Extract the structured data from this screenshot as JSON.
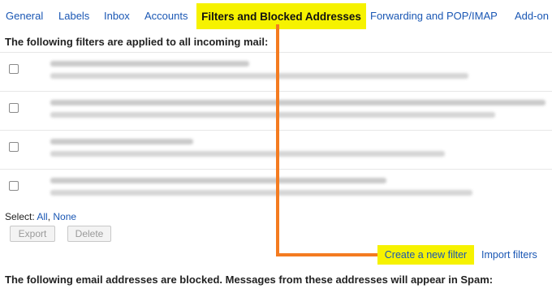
{
  "tabs": {
    "general": "General",
    "labels": "Labels",
    "inbox": "Inbox",
    "accounts": "Accounts",
    "filters": "Filters and Blocked Addresses",
    "forwarding": "Forwarding and POP/IMAP",
    "addons": "Add-on"
  },
  "filters_section": {
    "heading": "The following filters are applied to all incoming mail:"
  },
  "select": {
    "label": "Select:",
    "all": "All",
    "separator": ", ",
    "none": "None"
  },
  "buttons": {
    "export": "Export",
    "delete": "Delete"
  },
  "links": {
    "create_filter": "Create a new filter",
    "import_filters": "Import filters"
  },
  "blocked_section": {
    "heading": "The following email addresses are blocked. Messages from these addresses will appear in Spam:"
  },
  "colors": {
    "link": "#1a57b4",
    "highlight": "#f6f200",
    "annotation": "#f47b20"
  }
}
